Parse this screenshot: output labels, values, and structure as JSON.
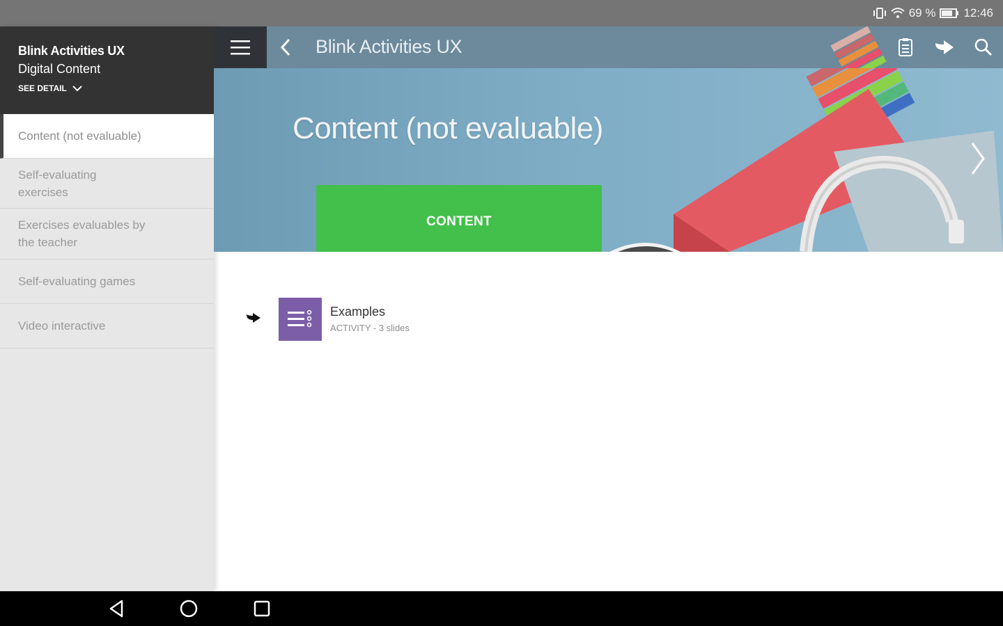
{
  "status_bar": {
    "battery_percent": "69 %",
    "time": "12:46"
  },
  "sidebar": {
    "book_title": "Blink Activities UX",
    "book_subtitle": "Digital Content",
    "see_detail": "SEE DETAIL",
    "items": [
      {
        "label": "Content (not evaluable)",
        "active": true
      },
      {
        "label": "Self-evaluating exercises",
        "active": false
      },
      {
        "label": "Exercises evaluables by the teacher",
        "active": false
      },
      {
        "label": "Self-evaluating games",
        "active": false
      },
      {
        "label": "Video interactive",
        "active": false
      }
    ]
  },
  "appbar": {
    "title": "Blink Activities UX",
    "icons": [
      "hamburger-icon",
      "back-arrow-icon",
      "notes-icon",
      "share-arrow-icon",
      "search-icon"
    ]
  },
  "hero": {
    "title": "Content (not evaluable)",
    "button_label": "CONTENT",
    "next_icon": "chevron-right-icon"
  },
  "content_list": [
    {
      "title": "Examples",
      "subtitle": "ACTIVITY - 3 slides",
      "icon": "activity-list-icon"
    }
  ],
  "nav_bar": {
    "icons": [
      "back-triangle-icon",
      "home-circle-icon",
      "recents-square-icon"
    ]
  },
  "colors": {
    "sidebar_header": "#333333",
    "appbar": "#6c8a9c",
    "content_button": "#43bf4b",
    "activity_tile": "#7c5ea8"
  }
}
